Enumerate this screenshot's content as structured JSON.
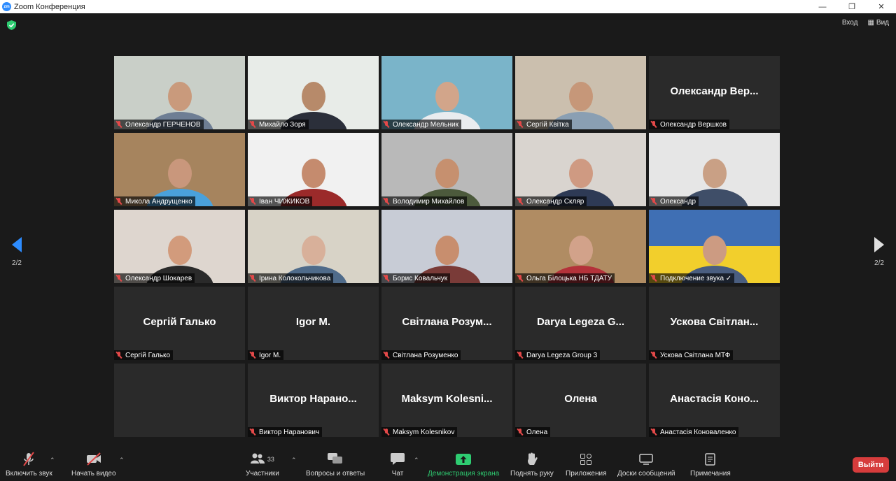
{
  "window": {
    "title": "Zoom Конференция",
    "logo_text": "zm"
  },
  "topbar": {
    "enter_label": "Вход",
    "view_label": "Вид"
  },
  "nav": {
    "left_page": "2/2",
    "right_page": "2/2"
  },
  "tiles": [
    {
      "label": "Олександр ГЕРЧЕНОВ",
      "video": true,
      "bg": "#c9cfc8",
      "skin": "#c99a7c",
      "shirt": "#6e7e94"
    },
    {
      "label": "Михайло Зоря",
      "video": true,
      "bg": "#e8ece8",
      "skin": "#b78a6a",
      "shirt": "#2b2f3a"
    },
    {
      "label": "Олександр Мельник",
      "video": true,
      "bg": "#7ab4c9",
      "skin": "#d2a58a",
      "shirt": "#e9ecef"
    },
    {
      "label": "Сергій Квітка",
      "video": true,
      "bg": "#cbbfae",
      "skin": "#c69779",
      "shirt": "#8a9fb3"
    },
    {
      "label": "Олександр Вершков",
      "video": false,
      "center": "Олександр Вер..."
    },
    {
      "label": "Микола Андрущенко",
      "video": true,
      "active": true,
      "bg": "#a6845e",
      "skin": "#c9977c",
      "shirt": "#4aa1db"
    },
    {
      "label": "Іван ЧИЖИКОВ",
      "video": true,
      "bg": "#f1f1f1",
      "skin": "#c58b6e",
      "shirt": "#9b2a2a"
    },
    {
      "label": "Володимир Михайлов",
      "video": true,
      "bg": "#b9b9b9",
      "skin": "#c6906f",
      "shirt": "#4c5a3c"
    },
    {
      "label": "Олександр Скляр",
      "video": true,
      "bg": "#d9d4cf",
      "skin": "#cf9a82",
      "shirt": "#2e3a55"
    },
    {
      "label": "Олександр",
      "video": true,
      "bg": "#e6e6e6",
      "skin": "#c9a085",
      "shirt": "#3f4e68"
    },
    {
      "label": "Олександр Шокарев",
      "video": true,
      "bg": "#ded6cf",
      "skin": "#d29b7c",
      "shirt": "#2a2a2a"
    },
    {
      "label": "Ірина Колокольчикова",
      "video": true,
      "bg": "#d8d3c7",
      "skin": "#d8b09a",
      "shirt": "#4f6b8a"
    },
    {
      "label": "Борис Ковальчук",
      "video": true,
      "bg": "#c8ccd6",
      "skin": "#c88e6e",
      "shirt": "#7a3b38"
    },
    {
      "label": "Ольга Білоцька НБ ТДАТУ",
      "video": true,
      "bg": "#b08c63",
      "skin": "#d2a28a",
      "shirt": "#b4323a"
    },
    {
      "label": "Подключение звука ✓",
      "video": true,
      "bg": "#3f6fb4",
      "skin": "#cc9b82",
      "shirt": "#4a5e80",
      "flag": true
    },
    {
      "label": "Сергій Галько",
      "video": false,
      "center": "Сергій Галько"
    },
    {
      "label": "Igor M.",
      "video": false,
      "center": "Igor M."
    },
    {
      "label": "Світлана Розуменко",
      "video": false,
      "center": "Світлана Розум..."
    },
    {
      "label": "Darya Legeza Group 3",
      "video": false,
      "center": "Darya Legeza G..."
    },
    {
      "label": "Ускова Світлана МТФ",
      "video": false,
      "center": "Ускова Світлан..."
    },
    {
      "label": "",
      "video": false,
      "center": "",
      "empty": true
    },
    {
      "label": "Виктор Наранович",
      "video": false,
      "center": "Виктор Нарано..."
    },
    {
      "label": "Maksym Kolesnikov",
      "video": false,
      "center": "Maksym Kolesni..."
    },
    {
      "label": "Олена",
      "video": false,
      "center": "Олена"
    },
    {
      "label": "Анастасія Коноваленко",
      "video": false,
      "center": "Анастасія Коно..."
    }
  ],
  "toolbar": {
    "unmute_label": "Включить звук",
    "start_video_label": "Начать видео",
    "participants_label": "Участники",
    "participants_count": "33",
    "qa_label": "Вопросы и ответы",
    "chat_label": "Чат",
    "share_label": "Демонстрация экрана",
    "raise_hand_label": "Поднять руку",
    "apps_label": "Приложения",
    "whiteboards_label": "Доски сообщений",
    "notes_label": "Примечания",
    "leave_label": "Выйти"
  }
}
